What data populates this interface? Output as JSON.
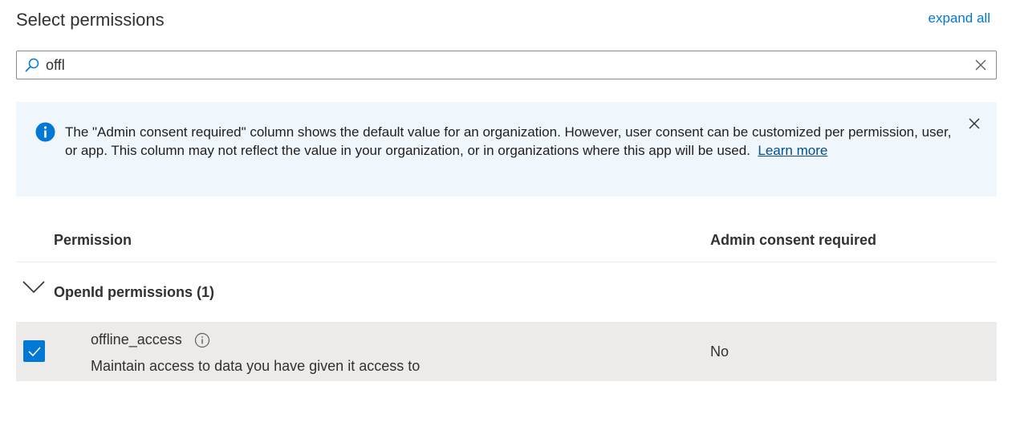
{
  "page": {
    "title": "Select permissions",
    "expand_all": "expand all"
  },
  "search": {
    "value": "offl",
    "placeholder": ""
  },
  "info": {
    "message": "The \"Admin consent required\" column shows the default value for an organization. However, user consent can be customized per permission, user, or app. This column may not reflect the value in your organization, or in organizations where this app will be used.",
    "link": "Learn more"
  },
  "table": {
    "columns": {
      "permission": "Permission",
      "admin_consent": "Admin consent required"
    },
    "group": {
      "label": "OpenId permissions (1)",
      "expanded": true
    },
    "rows": [
      {
        "name": "offline_access",
        "description": "Maintain access to data you have given it access to",
        "admin_consent": "No",
        "checked": true
      }
    ]
  },
  "colors": {
    "accent": "#0078d4",
    "info_background": "#eff6fc",
    "row_selected": "#edebe9"
  },
  "icons": {
    "search": "search-icon",
    "clear": "close-icon",
    "info": "info-icon",
    "dismiss": "close-icon",
    "chevron": "chevron-down-icon",
    "checkbox": "checkmark-icon",
    "permission_info": "info-circle-icon"
  }
}
